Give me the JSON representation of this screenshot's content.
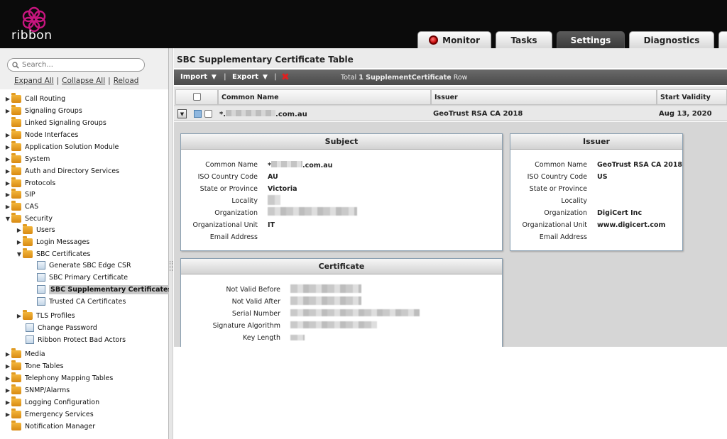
{
  "brand": {
    "name": "ribbon"
  },
  "tabs": [
    {
      "label": "Monitor",
      "icon": "red-status-dot"
    },
    {
      "label": "Tasks"
    },
    {
      "label": "Settings",
      "active": true
    },
    {
      "label": "Diagnostics"
    }
  ],
  "sidebar": {
    "search_placeholder": "Search...",
    "links": {
      "expand_all": "Expand All",
      "collapse_all": "Collapse All",
      "reload": "Reload"
    },
    "items": [
      {
        "label": "Call Routing"
      },
      {
        "label": "Signaling Groups"
      },
      {
        "label": "Linked Signaling Groups"
      },
      {
        "label": "Node Interfaces"
      },
      {
        "label": "Application Solution Module"
      },
      {
        "label": "System"
      },
      {
        "label": "Auth and Directory Services"
      },
      {
        "label": "Protocols"
      },
      {
        "label": "SIP"
      },
      {
        "label": "CAS"
      },
      {
        "label": "Security",
        "expanded": true
      },
      {
        "label": "Users"
      },
      {
        "label": "Login Messages"
      },
      {
        "label": "SBC Certificates",
        "expanded": true
      },
      {
        "label": "Generate SBC Edge CSR"
      },
      {
        "label": "SBC Primary Certificate"
      },
      {
        "label": "SBC Supplementary Certificates",
        "selected": true
      },
      {
        "label": "Trusted CA Certificates"
      },
      {
        "label": "TLS Profiles"
      },
      {
        "label": "Change Password"
      },
      {
        "label": "Ribbon Protect Bad Actors"
      },
      {
        "label": "Media"
      },
      {
        "label": "Tone Tables"
      },
      {
        "label": "Telephony Mapping Tables"
      },
      {
        "label": "SNMP/Alarms"
      },
      {
        "label": "Logging Configuration"
      },
      {
        "label": "Emergency Services"
      },
      {
        "label": "Notification Manager"
      }
    ]
  },
  "main": {
    "title": "SBC Supplementary Certificate Table",
    "toolbar": {
      "import_label": "Import",
      "export_label": "Export",
      "total_prefix": "Total",
      "total_bold": "1 SupplementCertificate",
      "total_suffix": "Row"
    },
    "columns": {
      "common_name": "Common Name",
      "issuer": "Issuer",
      "start_validity": "Start Validity"
    },
    "row": {
      "common_name_prefix": "*.",
      "common_name_suffix": ".com.au",
      "issuer": "GeoTrust RSA CA 2018",
      "start_validity": "Aug 13, 2020"
    },
    "subject_panel": {
      "title": "Subject",
      "labels": [
        "Common Name",
        "ISO Country Code",
        "State or Province",
        "Locality",
        "Organization",
        "Organizational Unit",
        "Email Address"
      ],
      "values": {
        "common_name_suffix": ".com.au",
        "iso": "AU",
        "state": "Victoria",
        "ou": "IT"
      }
    },
    "issuer_panel": {
      "title": "Issuer",
      "labels": [
        "Common Name",
        "ISO Country Code",
        "State or Province",
        "Locality",
        "Organization",
        "Organizational Unit",
        "Email Address"
      ],
      "values": {
        "common_name": "GeoTrust RSA CA 2018",
        "iso": "US",
        "organization": "DigiCert Inc",
        "ou": "www.digicert.com"
      }
    },
    "certificate_panel": {
      "title": "Certificate",
      "labels": [
        "Not Valid Before",
        "Not Valid After",
        "Serial Number",
        "Signature Algorithm",
        "Key Length"
      ]
    }
  }
}
